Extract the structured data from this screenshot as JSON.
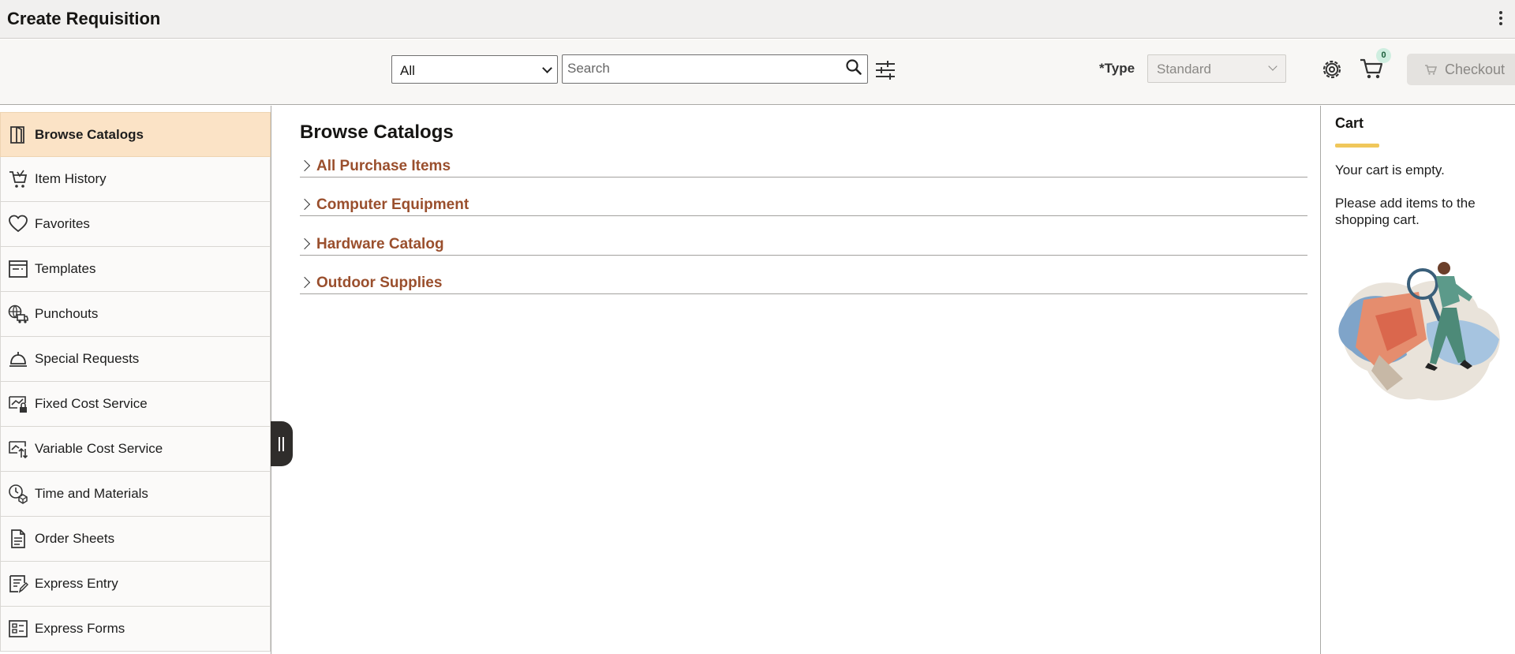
{
  "app": {
    "title": "Create Requisition"
  },
  "toolbar": {
    "scope_value": "All",
    "search_placeholder": "Search",
    "type_label": "*Type",
    "type_value": "Standard",
    "cart_count": "0",
    "checkout_label": "Checkout"
  },
  "sidebar": {
    "items": [
      {
        "label": "Browse Catalogs",
        "icon": "book-icon",
        "active": true
      },
      {
        "label": "Item History",
        "icon": "cart-history-icon"
      },
      {
        "label": "Favorites",
        "icon": "heart-icon"
      },
      {
        "label": "Templates",
        "icon": "template-icon"
      },
      {
        "label": "Punchouts",
        "icon": "globe-truck-icon"
      },
      {
        "label": "Special Requests",
        "icon": "service-bell-icon"
      },
      {
        "label": "Fixed Cost Service",
        "icon": "fixed-cost-icon"
      },
      {
        "label": "Variable Cost Service",
        "icon": "variable-cost-icon"
      },
      {
        "label": "Time and Materials",
        "icon": "clock-box-icon"
      },
      {
        "label": "Order Sheets",
        "icon": "document-icon"
      },
      {
        "label": "Express Entry",
        "icon": "express-entry-icon"
      },
      {
        "label": "Express Forms",
        "icon": "form-icon"
      }
    ]
  },
  "main": {
    "heading": "Browse Catalogs",
    "catalogs": [
      {
        "label": "All Purchase Items"
      },
      {
        "label": "Computer Equipment"
      },
      {
        "label": "Hardware Catalog"
      },
      {
        "label": "Outdoor Supplies"
      }
    ]
  },
  "cart": {
    "title": "Cart",
    "empty_text": "Your cart is empty.",
    "hint_text": "Please add items to the shopping cart."
  },
  "colors": {
    "active_nav": "#fbe3c6",
    "catalog_link": "#9a4f2d",
    "cart_accent": "#f0c75b"
  }
}
